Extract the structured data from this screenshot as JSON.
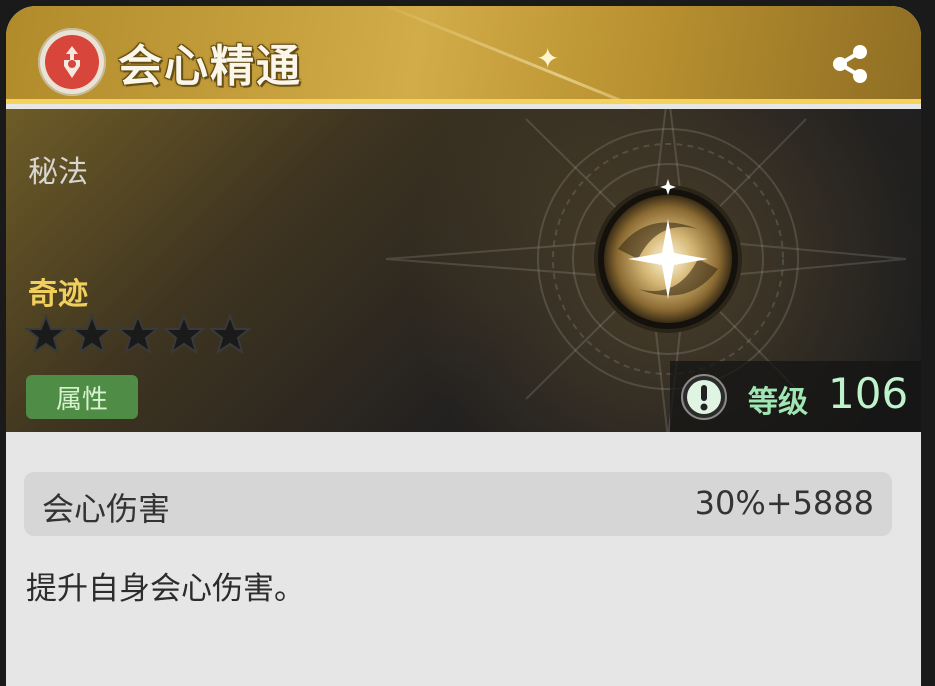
{
  "header": {
    "title": "会心精通",
    "emblem_icon": "red-crest-icon",
    "share_icon": "share-icon",
    "accent_color": "#d2ac48"
  },
  "hero": {
    "type_label": "秘法",
    "rarity_label": "奇迹",
    "stars": {
      "filled": 0,
      "total": 5
    },
    "attribute_tag": "属性",
    "level_label": "等级",
    "level_value": "106",
    "info_icon": "exclamation-icon",
    "emblem": "golden-star-orb"
  },
  "stat": {
    "name": "会心伤害",
    "value": "30%+5888"
  },
  "description": "提升自身会心伤害。"
}
